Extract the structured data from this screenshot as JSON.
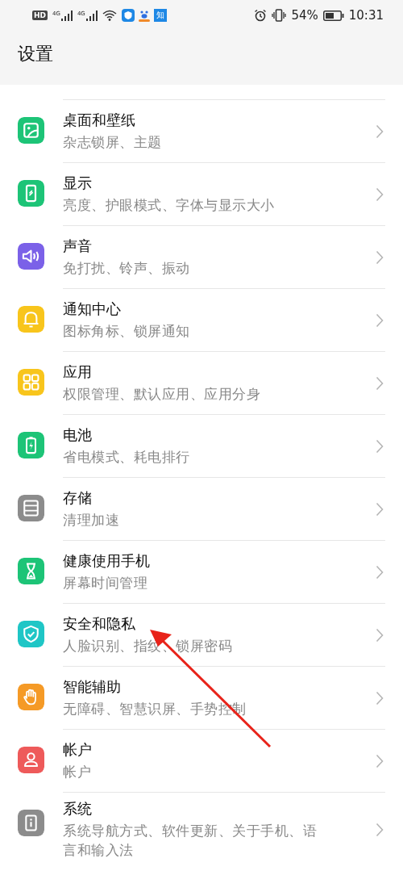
{
  "status_bar": {
    "hd": "HD",
    "networks": [
      "4G",
      "4G"
    ],
    "app_badge": "知",
    "battery": "54%",
    "time": "10:31"
  },
  "header": {
    "title": "设置"
  },
  "items": [
    {
      "kind": "wallpaper",
      "color": "#1dc477",
      "title": "桌面和壁纸",
      "subtitle": "杂志锁屏、主题"
    },
    {
      "kind": "display",
      "color": "#1dc477",
      "title": "显示",
      "subtitle": "亮度、护眼模式、字体与显示大小"
    },
    {
      "kind": "sound",
      "color": "#7b61e8",
      "title": "声音",
      "subtitle": "免打扰、铃声、振动"
    },
    {
      "kind": "bell",
      "color": "#f8c51c",
      "title": "通知中心",
      "subtitle": "图标角标、锁屏通知"
    },
    {
      "kind": "apps",
      "color": "#f8c51c",
      "title": "应用",
      "subtitle": "权限管理、默认应用、应用分身"
    },
    {
      "kind": "battery",
      "color": "#1dc477",
      "title": "电池",
      "subtitle": "省电模式、耗电排行"
    },
    {
      "kind": "storage",
      "color": "#8c8c8c",
      "title": "存储",
      "subtitle": "清理加速"
    },
    {
      "kind": "hourglass",
      "color": "#1dc477",
      "title": "健康使用手机",
      "subtitle": "屏幕时间管理"
    },
    {
      "kind": "shield",
      "color": "#1fc6c6",
      "title": "安全和隐私",
      "subtitle": "人脸识别、指纹、锁屏密码"
    },
    {
      "kind": "hand",
      "color": "#f59a26",
      "title": "智能辅助",
      "subtitle": "无障碍、智慧识屏、手势控制"
    },
    {
      "kind": "person",
      "color": "#ee5a5a",
      "title": "帐户",
      "subtitle": "帐户"
    },
    {
      "kind": "info",
      "color": "#8c8c8c",
      "title": "系统",
      "subtitle": "系统导航方式、软件更新、关于手机、语言和输入法"
    }
  ]
}
